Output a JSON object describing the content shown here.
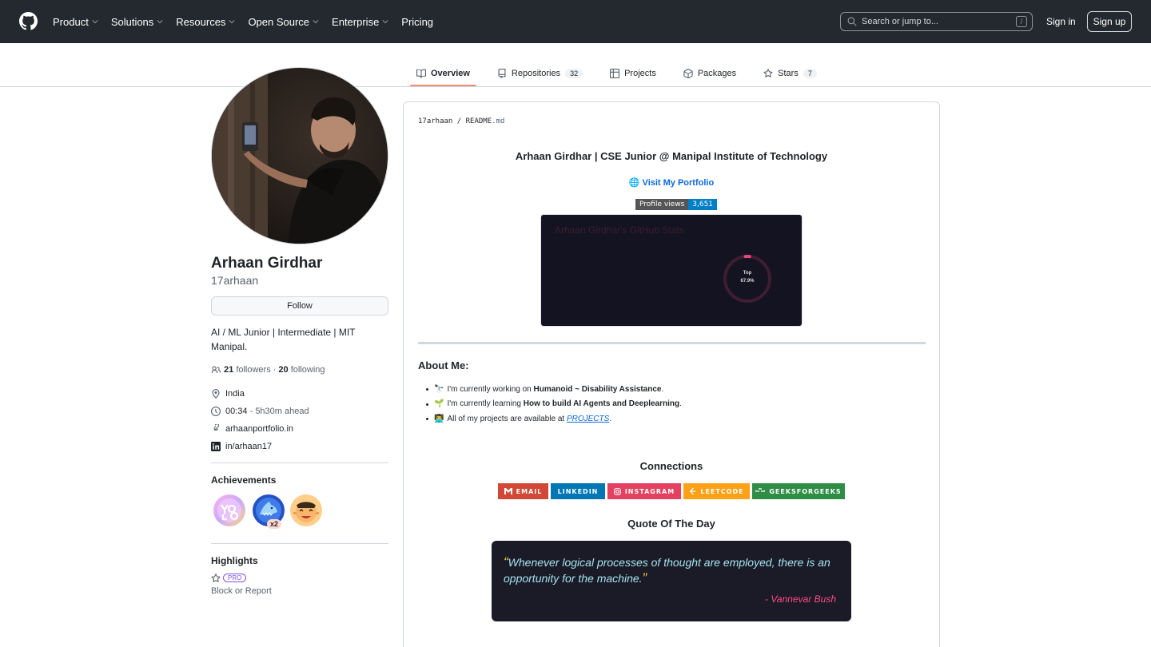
{
  "header": {
    "nav": [
      {
        "label": "Product",
        "has_menu": true
      },
      {
        "label": "Solutions",
        "has_menu": true
      },
      {
        "label": "Resources",
        "has_menu": true
      },
      {
        "label": "Open Source",
        "has_menu": true
      },
      {
        "label": "Enterprise",
        "has_menu": true
      },
      {
        "label": "Pricing",
        "has_menu": false
      }
    ],
    "search_placeholder": "Search or jump to...",
    "search_shortcut": "/",
    "sign_in": "Sign in",
    "sign_up": "Sign up"
  },
  "tabs": [
    {
      "label": "Overview",
      "icon": "book-icon",
      "active": true
    },
    {
      "label": "Repositories",
      "icon": "repo-icon",
      "count": "32"
    },
    {
      "label": "Projects",
      "icon": "table-icon"
    },
    {
      "label": "Packages",
      "icon": "package-icon"
    },
    {
      "label": "Stars",
      "icon": "star-icon",
      "count": "7"
    }
  ],
  "profile": {
    "name": "Arhaan Girdhar",
    "login": "17arhaan",
    "follow_label": "Follow",
    "bio": "AI / ML Junior | Intermediate | MIT Manipal.",
    "followers_count": "21",
    "followers_label": "followers",
    "separator": "·",
    "following_count": "20",
    "following_label": "following",
    "location": "India",
    "local_time": "00:34",
    "time_offset": "- 5h30m ahead",
    "website": "arhaanportfolio.in",
    "linkedin": "in/arhaan17",
    "achievements_title": "Achievements",
    "achievement_multiplier": "x2",
    "highlights_title": "Highlights",
    "pro_badge": "PRO",
    "block_report": "Block or Report"
  },
  "readme": {
    "path_user": "17arhaan",
    "path_sep": "/",
    "path_file": "README",
    "path_ext": ".md",
    "title": "Arhaan Girdhar | CSE Junior @ Manipal Institute of Technology",
    "portfolio_link": "🌐 Visit My Portfolio",
    "views_label": "Profile views",
    "views_count": "3,651",
    "stats_title": "Arhaan Girdhar's GitHub Stats",
    "rank_label": "Top",
    "rank_value": "67.9%",
    "rank_fraction": 0.03,
    "about_title": "About Me:",
    "items": [
      {
        "emoji": "🔭",
        "prefix": "I'm currently working on ",
        "bold": "Humanoid ~ Disability Assistance",
        "suffix": "."
      },
      {
        "emoji": "🌱",
        "prefix": "I'm currently learning ",
        "bold": "How to build AI Agents and Deeplearning",
        "suffix": "."
      },
      {
        "emoji": "👨‍💻",
        "prefix": "All of my projects are available at ",
        "link": "PROJECTS",
        "suffix": "."
      }
    ],
    "connections_title": "Connections",
    "socials": [
      {
        "label": "EMAIL",
        "color": "#D14836",
        "icon": "gmail-icon"
      },
      {
        "label": "LINKEDIN",
        "color": "#0077B5",
        "icon": ""
      },
      {
        "label": "INSTAGRAM",
        "color": "#E4405F",
        "icon": "instagram-icon"
      },
      {
        "label": "LEETCODE",
        "color": "#FFA116",
        "icon": "leetcode-icon"
      },
      {
        "label": "GEEKSFORGEEKS",
        "color": "#2F8D46",
        "icon": "gfg-icon"
      }
    ],
    "quote_title": "Quote Of The Day",
    "quote_text": "Whenever logical processes of thought are employed, there is an opportunity for the machine.",
    "quote_author": "- Vannevar Bush"
  }
}
